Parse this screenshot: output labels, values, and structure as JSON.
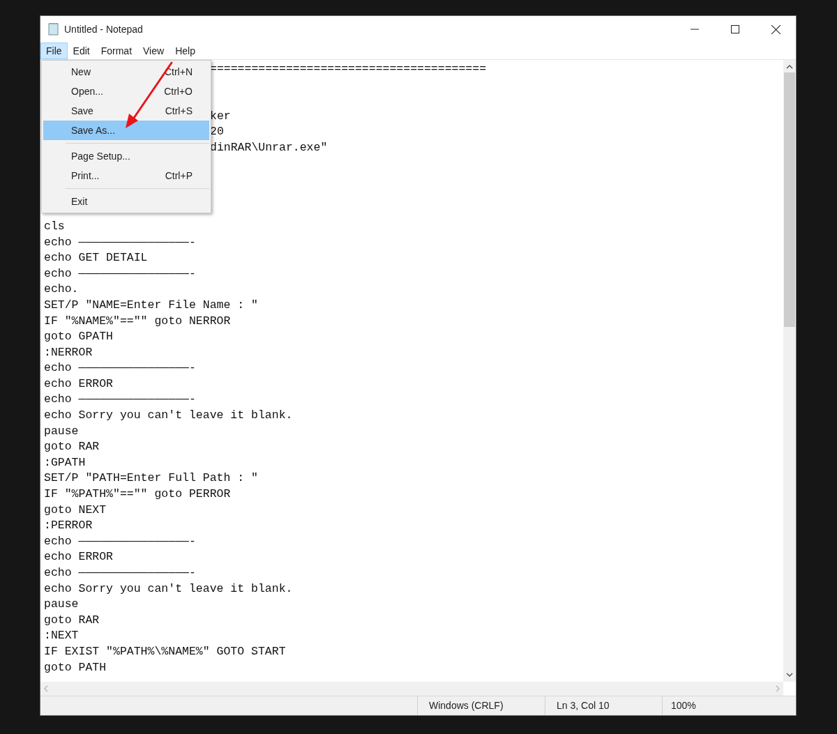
{
  "window": {
    "title": "Untitled - Notepad"
  },
  "menu_bar": [
    {
      "label": "File",
      "selected": true
    },
    {
      "label": "Edit",
      "selected": false
    },
    {
      "label": "Format",
      "selected": false
    },
    {
      "label": "View",
      "selected": false
    },
    {
      "label": "Help",
      "selected": false
    }
  ],
  "file_menu": [
    {
      "kind": "item",
      "label": "New",
      "shortcut": "Ctrl+N",
      "selected": false
    },
    {
      "kind": "item",
      "label": "Open...",
      "shortcut": "Ctrl+O",
      "selected": false
    },
    {
      "kind": "item",
      "label": "Save",
      "shortcut": "Ctrl+S",
      "selected": false
    },
    {
      "kind": "item",
      "label": "Save As...",
      "selected": true
    },
    {
      "kind": "separator"
    },
    {
      "kind": "item",
      "label": "Page Setup...",
      "selected": false
    },
    {
      "kind": "item",
      "label": "Print...",
      "shortcut": "Ctrl+P",
      "selected": false
    },
    {
      "kind": "separator"
    },
    {
      "kind": "item",
      "label": "Exit",
      "selected": false
    }
  ],
  "editor_lines": [
    {
      "kind": "partial",
      "text": "========================================"
    },
    {
      "kind": "blank"
    },
    {
      "kind": "blank"
    },
    {
      "kind": "partial",
      "text": "ker"
    },
    {
      "kind": "partial",
      "text": "20"
    },
    {
      "kind": "partial",
      "text": "dinRAR\\Unrar.exe\""
    },
    {
      "kind": "blank"
    },
    {
      "kind": "blank"
    },
    {
      "kind": "blank"
    },
    {
      "kind": "blank"
    },
    {
      "kind": "text",
      "text": "cls"
    },
    {
      "kind": "text",
      "text": "echo ————————————————-"
    },
    {
      "kind": "text",
      "text": "echo GET DETAIL"
    },
    {
      "kind": "text",
      "text": "echo ————————————————-"
    },
    {
      "kind": "text",
      "text": "echo."
    },
    {
      "kind": "text",
      "text": "SET/P \"NAME=Enter File Name : \""
    },
    {
      "kind": "text",
      "text": "IF \"%NAME%\"==\"\" goto NERROR"
    },
    {
      "kind": "text",
      "text": "goto GPATH"
    },
    {
      "kind": "text",
      "text": ":NERROR"
    },
    {
      "kind": "text",
      "text": "echo ————————————————-"
    },
    {
      "kind": "text",
      "text": "echo ERROR"
    },
    {
      "kind": "text",
      "text": "echo ————————————————-"
    },
    {
      "kind": "text",
      "text": "echo Sorry you can't leave it blank."
    },
    {
      "kind": "text",
      "text": "pause"
    },
    {
      "kind": "text",
      "text": "goto RAR"
    },
    {
      "kind": "text",
      "text": ":GPATH"
    },
    {
      "kind": "text",
      "text": "SET/P \"PATH=Enter Full Path : \""
    },
    {
      "kind": "text",
      "text": "IF \"%PATH%\"==\"\" goto PERROR"
    },
    {
      "kind": "text",
      "text": "goto NEXT"
    },
    {
      "kind": "text",
      "text": ":PERROR"
    },
    {
      "kind": "text",
      "text": "echo ————————————————-"
    },
    {
      "kind": "text",
      "text": "echo ERROR"
    },
    {
      "kind": "text",
      "text": "echo ————————————————-"
    },
    {
      "kind": "text",
      "text": "echo Sorry you can't leave it blank."
    },
    {
      "kind": "text",
      "text": "pause"
    },
    {
      "kind": "text",
      "text": "goto RAR"
    },
    {
      "kind": "text",
      "text": ":NEXT"
    },
    {
      "kind": "text",
      "text": "IF EXIST \"%PATH%\\%NAME%\" GOTO START"
    },
    {
      "kind": "text",
      "text": "goto PATH"
    }
  ],
  "status_bar": {
    "line_ending": "Windows (CRLF)",
    "position": "Ln 3, Col 10",
    "zoom": "100%"
  }
}
